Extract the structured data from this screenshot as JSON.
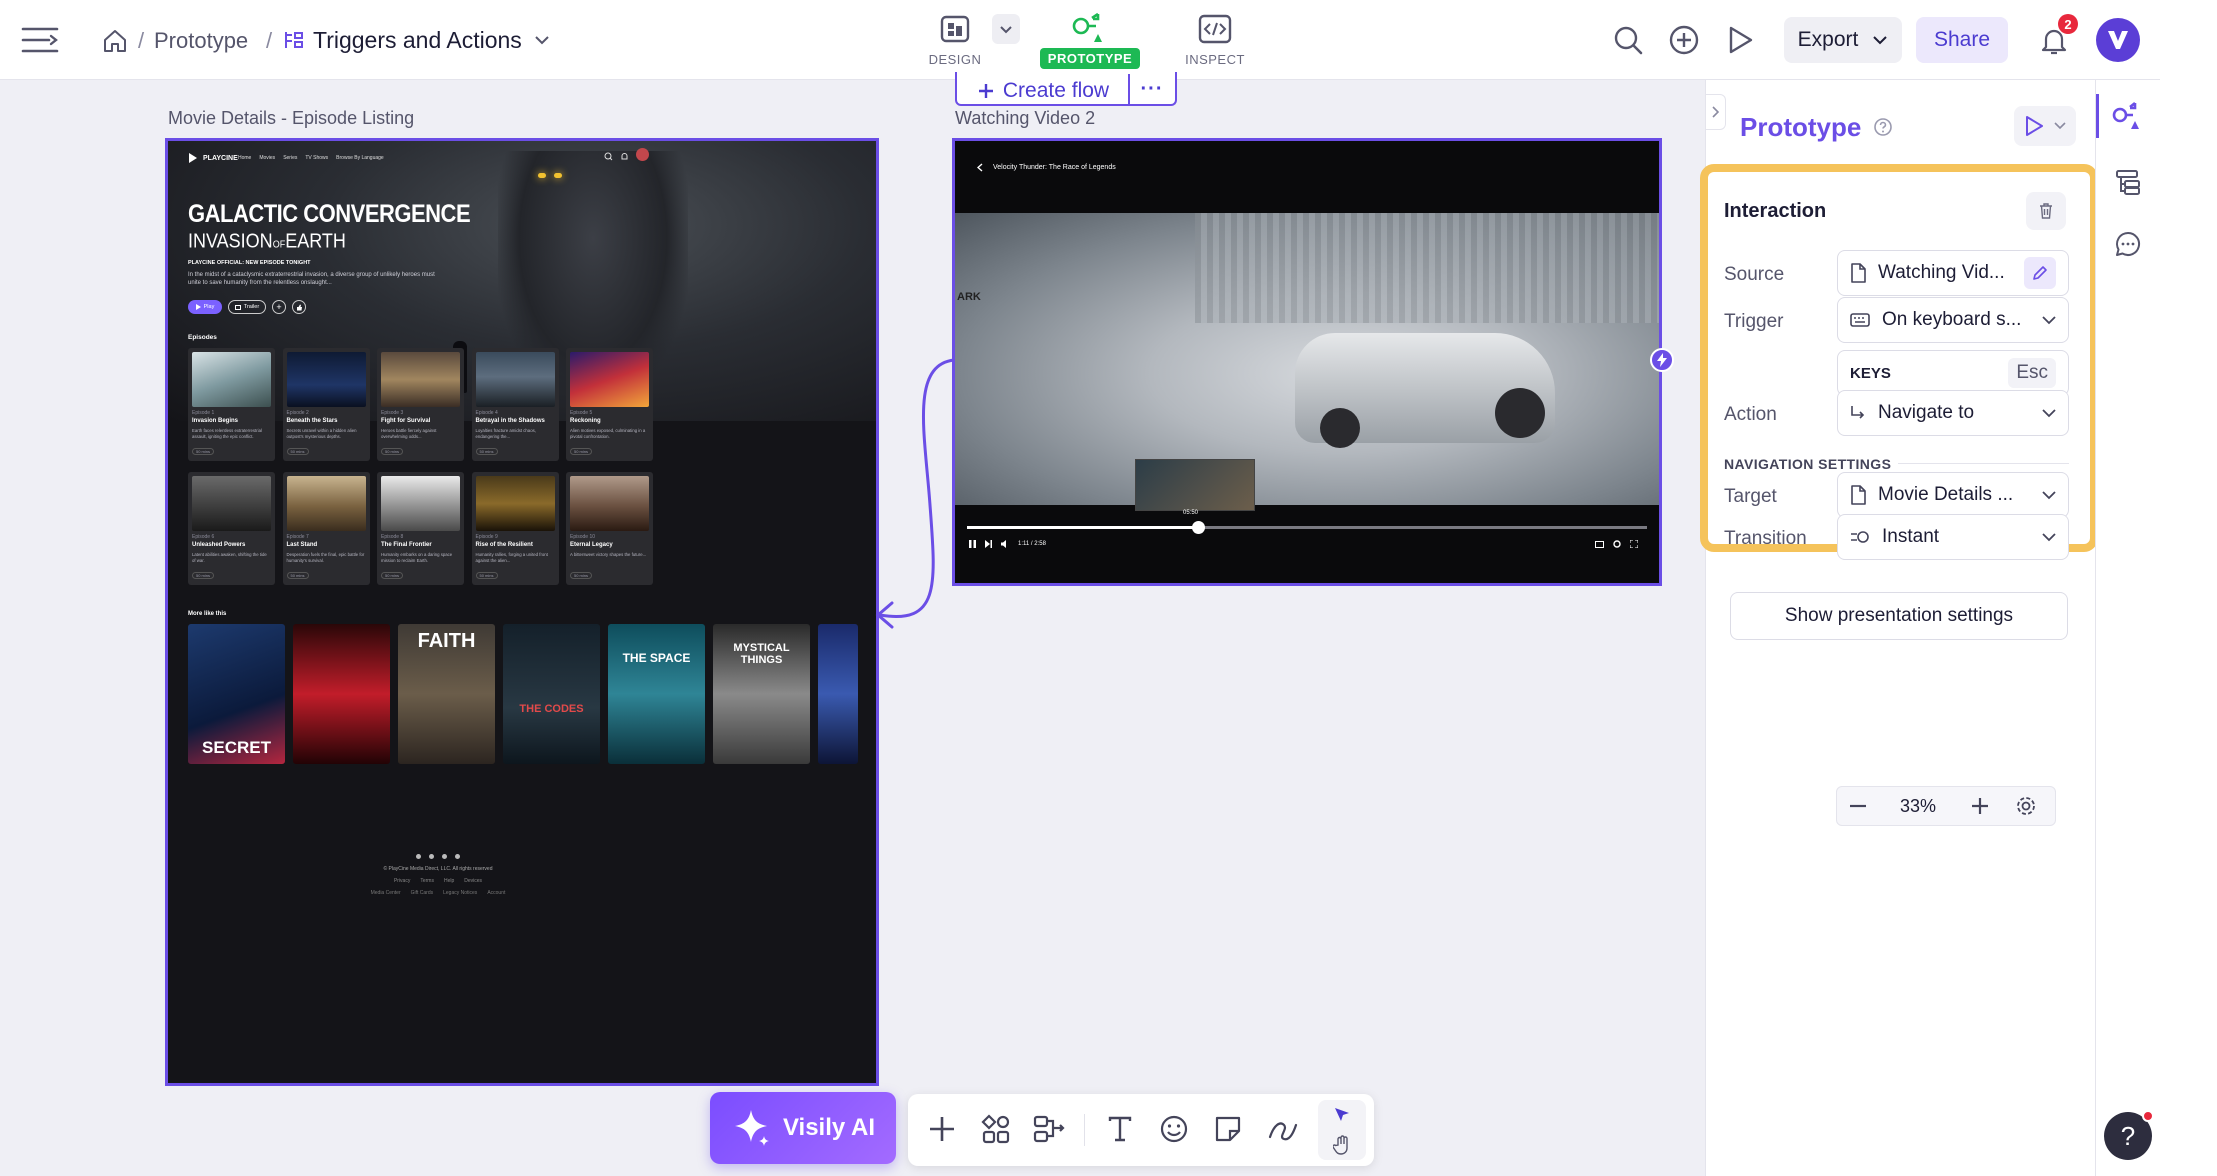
{
  "topbar": {
    "breadcrumb_project": "Prototype",
    "breadcrumb_sep": "/",
    "page_title": "Triggers and Actions",
    "modes": [
      {
        "label": "DESIGN"
      },
      {
        "label": "PROTOTYPE"
      },
      {
        "label": "INSPECT"
      }
    ],
    "export_label": "Export",
    "share_label": "Share",
    "notif_count": "2",
    "accent": "#6b4ee6",
    "proto_green": "#1db954"
  },
  "canvas": {
    "create_flow_label": "Create flow",
    "more_label": "···",
    "frame1_label": "Movie Details - Episode Listing",
    "frame2_label": "Watching Video 2"
  },
  "movie": {
    "brand": "PLAYCINE",
    "nav": [
      "Home",
      "Movies",
      "Series",
      "TV Shows",
      "Browse By Language"
    ],
    "hero_title_1": "GALACTIC CONVERGENCE",
    "hero_title_2a": "INVASION",
    "hero_title_2b": "OF",
    "hero_title_2c": "EARTH",
    "hero_sub": "PLAYCINE OFFICIAL: NEW EPISODE TONIGHT",
    "hero_desc": "In the midst of a cataclysmic extraterrestrial invasion, a diverse group of unlikely heroes must unite to save humanity from the relentless onslaught...",
    "play_label": "Play",
    "trailer_label": "Trailer",
    "episodes_heading": "Episodes",
    "episodes": [
      {
        "num": "Episode 1",
        "title": "Invasion Begins",
        "desc": "Earth faces relentless extraterrestrial assault, igniting the epic conflict.",
        "dur": "50 mins"
      },
      {
        "num": "Episode 2",
        "title": "Beneath the Stars",
        "desc": "Secrets unravel within a hidden alien outpost's mysterious depths.",
        "dur": "50 mins"
      },
      {
        "num": "Episode 3",
        "title": "Fight for Survival",
        "desc": "Heroes battle fiercely against overwhelming odds...",
        "dur": "50 mins"
      },
      {
        "num": "Episode 4",
        "title": "Betrayal in the Shadows",
        "desc": "Loyalties fracture amidst chaos, endangering the...",
        "dur": "50 mins"
      },
      {
        "num": "Episode 5",
        "title": "Reckoning",
        "desc": "Alien motives exposed, culminating in a pivotal confrontation.",
        "dur": "50 mins"
      },
      {
        "num": "Episode 6",
        "title": "Unleashed Powers",
        "desc": "Latent abilities awaken, shifting the tide of war.",
        "dur": "50 mins"
      },
      {
        "num": "Episode 7",
        "title": "Last Stand",
        "desc": "Desperation fuels the final, epic battle for humanity's survival.",
        "dur": "50 mins"
      },
      {
        "num": "Episode 8",
        "title": "The Final Frontier",
        "desc": "Humanity embarks on a daring space mission to reclaim Earth.",
        "dur": "50 mins"
      },
      {
        "num": "Episode 9",
        "title": "Rise of the Resilient",
        "desc": "Humanity rallies, forging a united front against the alien...",
        "dur": "50 mins"
      },
      {
        "num": "Episode 10",
        "title": "Eternal Legacy",
        "desc": "A bittersweet victory shapes the future...",
        "dur": "50 mins"
      }
    ],
    "more_heading": "More like this",
    "posters": [
      "SECRET",
      "",
      "FAITH",
      "THE CODES",
      "THE SPACE",
      "MYSTICAL THINGS",
      ""
    ],
    "footer_copyright": "© PlayCine Media Direct, LLC. All rights reserved",
    "footer_links_1": [
      "Privacy",
      "Terms",
      "Help",
      "Devices"
    ],
    "footer_links_2": [
      "Media Center",
      "Gift Cards",
      "Legacy Notices",
      "Account"
    ]
  },
  "video": {
    "title": "Velocity Thunder: The Race of Legends",
    "preview_time": "05:50",
    "time": "1:11 / 2:58",
    "progress": 0.34,
    "sign_text": "ARK"
  },
  "panel": {
    "title": "Prototype",
    "section_title": "Interaction",
    "source_label": "Source",
    "source_value": "Watching Vid...",
    "trigger_label": "Trigger",
    "trigger_value": "On keyboard s...",
    "keys_label": "KEYS",
    "keys_value": "Esc",
    "action_label": "Action",
    "action_value": "Navigate to",
    "nav_settings_heading": "NAVIGATION SETTINGS",
    "target_label": "Target",
    "target_value": "Movie Details ...",
    "transition_label": "Transition",
    "transition_value": "Instant",
    "presentation_button": "Show presentation settings",
    "highlight_color": "#f5c35b"
  },
  "bottom": {
    "ai_label": "Visily AI",
    "zoom": "33%"
  }
}
